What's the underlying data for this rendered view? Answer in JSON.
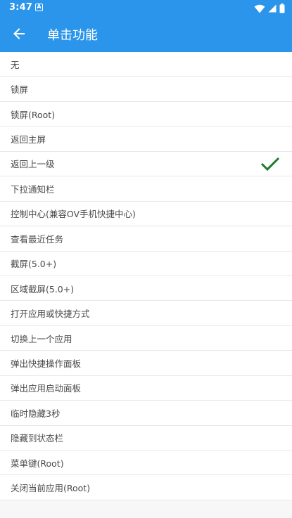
{
  "status_bar": {
    "time": "3:47",
    "notification_letter": "A"
  },
  "app_bar": {
    "title": "单击功能",
    "back_icon": "arrow-left-icon"
  },
  "list": {
    "items": [
      {
        "label": "无",
        "selected": false
      },
      {
        "label": "锁屏",
        "selected": false
      },
      {
        "label": "锁屏(Root)",
        "selected": false
      },
      {
        "label": "返回主屏",
        "selected": false
      },
      {
        "label": "返回上一级",
        "selected": true
      },
      {
        "label": "下拉通知栏",
        "selected": false
      },
      {
        "label": "控制中心(兼容OV手机快捷中心)",
        "selected": false
      },
      {
        "label": "查看最近任务",
        "selected": false
      },
      {
        "label": "截屏(5.0+)",
        "selected": false
      },
      {
        "label": "区域截屏(5.0+)",
        "selected": false
      },
      {
        "label": "打开应用或快捷方式",
        "selected": false
      },
      {
        "label": "切换上一个应用",
        "selected": false
      },
      {
        "label": "弹出快捷操作面板",
        "selected": false
      },
      {
        "label": "弹出应用启动面板",
        "selected": false
      },
      {
        "label": "临时隐藏3秒",
        "selected": false
      },
      {
        "label": "隐藏到状态栏",
        "selected": false
      },
      {
        "label": "菜单键(Root)",
        "selected": false
      },
      {
        "label": "关闭当前应用(Root)",
        "selected": false
      }
    ]
  },
  "colors": {
    "primary": "#2a95ea",
    "check": "#1d7a2e",
    "text": "#4a4a4a",
    "background": "#f7f7f7"
  }
}
